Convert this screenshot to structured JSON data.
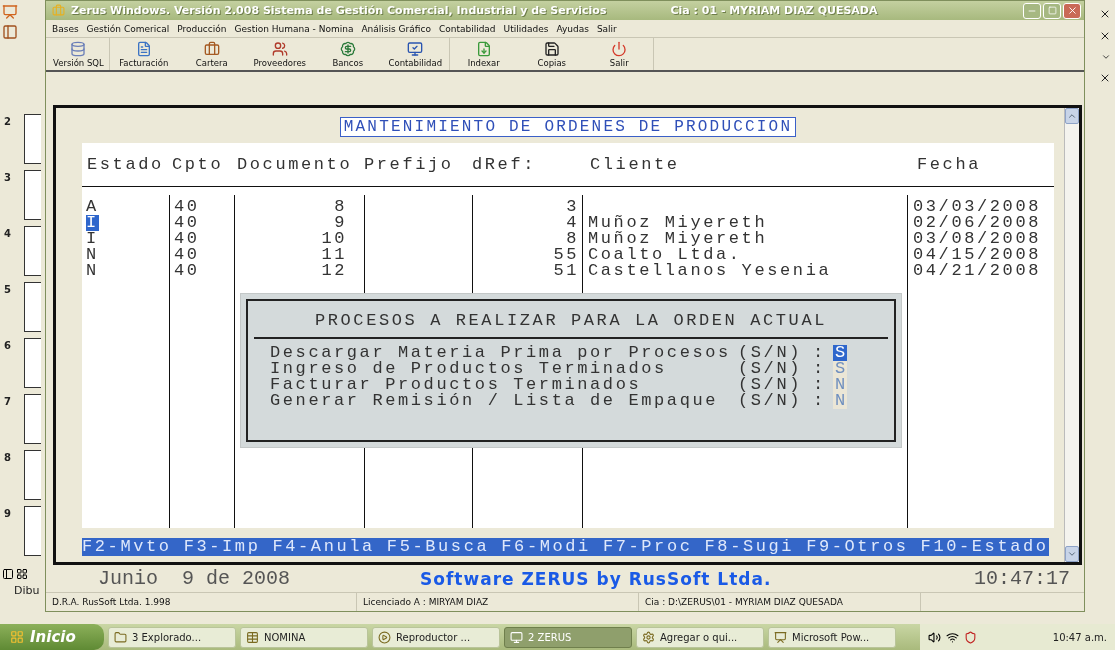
{
  "left_panel": {
    "slides": [
      "2",
      "3",
      "4",
      "5",
      "6",
      "7",
      "8",
      "9"
    ],
    "footer_label": "Dibu"
  },
  "window": {
    "title": "Zerus Windows. Versión 2.008 Sistema de Gestión Comercial, Industrial y de Servicios",
    "company": "Cia : 01  - MYRIAM DIAZ QUESADA"
  },
  "menu": [
    "Bases",
    "Gestión Comerical",
    "Producción",
    "Gestion Humana - Nomina",
    "Análisis Gráfico",
    "Contabilidad",
    "Utilidades",
    "Ayudas",
    "Salir"
  ],
  "toolbar": [
    "Versión SQL",
    "Facturación",
    "Cartera",
    "Proveedores",
    "Bancos",
    "Contabilidad",
    "Indexar",
    "Copias",
    "Salir"
  ],
  "screen_title": "MANTENIMIENTO DE ORDENES DE PRODUCCION",
  "table": {
    "columns": [
      "Estado",
      "Cpto",
      "Documento",
      "Prefijo",
      "dRef:",
      "Cliente",
      "Fecha"
    ],
    "rows": [
      {
        "estado": "A",
        "cpto": "40",
        "documento": "8",
        "dref": "3",
        "cliente": "",
        "fecha": "03/03/2008",
        "selected": false
      },
      {
        "estado": "I",
        "cpto": "40",
        "documento": "9",
        "dref": "4",
        "cliente": "Muñoz Miyereth",
        "fecha": "02/06/2008",
        "selected": true
      },
      {
        "estado": "I",
        "cpto": "40",
        "documento": "10",
        "dref": "8",
        "cliente": "Muñoz Miyereth",
        "fecha": "03/08/2008",
        "selected": false
      },
      {
        "estado": "N",
        "cpto": "40",
        "documento": "11",
        "dref": "55",
        "cliente": "Coalto Ltda.",
        "fecha": "04/15/2008",
        "selected": false
      },
      {
        "estado": "N",
        "cpto": "40",
        "documento": "12",
        "dref": "51",
        "cliente": "Castellanos Yesenia",
        "fecha": "04/21/2008",
        "selected": false
      }
    ]
  },
  "dialog": {
    "title": "PROCESOS A REALIZAR PARA LA ORDEN ACTUAL",
    "options": [
      {
        "label": "Descargar Materia Prima por Procesos",
        "format": "(S/N)",
        "separator": ":",
        "value": "S",
        "selected": true
      },
      {
        "label": "Ingreso de Productos Terminados",
        "format": "(S/N)",
        "separator": ":",
        "value": "S",
        "selected": false
      },
      {
        "label": "Facturar Productos Terminados",
        "format": "(S/N)",
        "separator": ":",
        "value": "N",
        "selected": false
      },
      {
        "label": "Generar Remisión / Lista de Empaque",
        "format": "(S/N)",
        "separator": ":",
        "value": "N",
        "selected": false
      }
    ]
  },
  "function_keys": [
    "F2-Mvto",
    "F3-Imp",
    "F4-Anula",
    "F5-Busca",
    "F6-Modi",
    "F7-Proc",
    "F8-Sugi",
    "F9-Otros",
    "F10-Estado"
  ],
  "date": "Junio  9 de 2008",
  "brand": "Software ZERUS by RusSoft Ltda.",
  "clock": "10:47:17",
  "status_bar": [
    "D.R.A. RusSoft Ltda. 1.998",
    "Licenciado A : MIRYAM DIAZ",
    "Cia : D:\\ZERUS\\01 - MYRIAM DIAZ QUESADA"
  ],
  "taskbar": {
    "start": "Inicio",
    "items": [
      {
        "label": "3 Explorado...",
        "selected": false
      },
      {
        "label": "NOMINA",
        "selected": false
      },
      {
        "label": "Reproductor ...",
        "selected": false
      },
      {
        "label": "2 ZERUS",
        "selected": true
      },
      {
        "label": "Agregar o qui...",
        "selected": false
      },
      {
        "label": "Microsoft Pow...",
        "selected": false
      }
    ],
    "time": "10:47 a.m."
  }
}
